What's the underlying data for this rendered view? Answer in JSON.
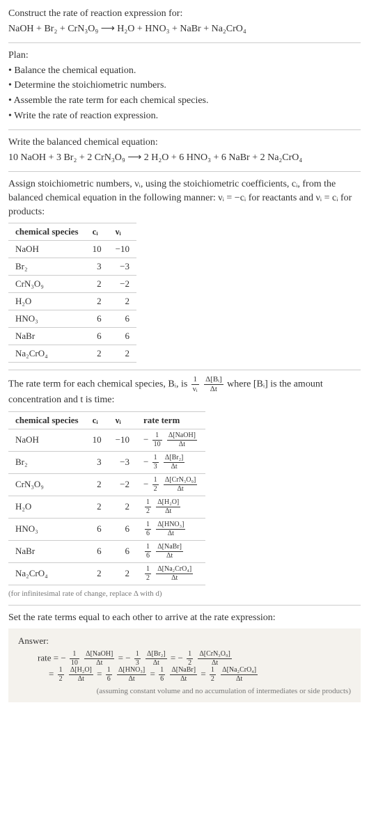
{
  "intro": {
    "title": "Construct the rate of reaction expression for:",
    "equation": "NaOH + Br₂ + CrN₃O₉ ⟶ H₂O + HNO₃ + NaBr + Na₂CrO₄"
  },
  "plan": {
    "heading": "Plan:",
    "items": [
      "• Balance the chemical equation.",
      "• Determine the stoichiometric numbers.",
      "• Assemble the rate term for each chemical species.",
      "• Write the rate of reaction expression."
    ]
  },
  "balanced": {
    "heading": "Write the balanced chemical equation:",
    "equation": "10 NaOH + 3 Br₂ + 2 CrN₃O₉ ⟶ 2 H₂O + 6 HNO₃ + 6 NaBr + 2 Na₂CrO₄"
  },
  "assign": {
    "text": "Assign stoichiometric numbers, νᵢ, using the stoichiometric coefficients, cᵢ, from the balanced chemical equation in the following manner: νᵢ = −cᵢ for reactants and νᵢ = cᵢ for products:"
  },
  "table1": {
    "headers": [
      "chemical species",
      "cᵢ",
      "νᵢ"
    ],
    "rows": [
      {
        "species": "NaOH",
        "c": "10",
        "v": "−10"
      },
      {
        "species": "Br₂",
        "c": "3",
        "v": "−3"
      },
      {
        "species": "CrN₃O₉",
        "c": "2",
        "v": "−2"
      },
      {
        "species": "H₂O",
        "c": "2",
        "v": "2"
      },
      {
        "species": "HNO₃",
        "c": "6",
        "v": "6"
      },
      {
        "species": "NaBr",
        "c": "6",
        "v": "6"
      },
      {
        "species": "Na₂CrO₄",
        "c": "2",
        "v": "2"
      }
    ]
  },
  "rate_intro": {
    "part1": "The rate term for each chemical species, Bᵢ, is ",
    "frac1_num": "1",
    "frac1_den": "νᵢ",
    "frac2_num": "Δ[Bᵢ]",
    "frac2_den": "Δt",
    "part2": " where [Bᵢ] is the amount concentration and t is time:"
  },
  "table2": {
    "headers": [
      "chemical species",
      "cᵢ",
      "νᵢ",
      "rate term"
    ],
    "rows": [
      {
        "species": "NaOH",
        "c": "10",
        "v": "−10",
        "neg": "−",
        "coef_num": "1",
        "coef_den": "10",
        "d_num": "Δ[NaOH]",
        "d_den": "Δt"
      },
      {
        "species": "Br₂",
        "c": "3",
        "v": "−3",
        "neg": "−",
        "coef_num": "1",
        "coef_den": "3",
        "d_num": "Δ[Br₂]",
        "d_den": "Δt"
      },
      {
        "species": "CrN₃O₉",
        "c": "2",
        "v": "−2",
        "neg": "−",
        "coef_num": "1",
        "coef_den": "2",
        "d_num": "Δ[CrN₃O₉]",
        "d_den": "Δt"
      },
      {
        "species": "H₂O",
        "c": "2",
        "v": "2",
        "neg": "",
        "coef_num": "1",
        "coef_den": "2",
        "d_num": "Δ[H₂O]",
        "d_den": "Δt"
      },
      {
        "species": "HNO₃",
        "c": "6",
        "v": "6",
        "neg": "",
        "coef_num": "1",
        "coef_den": "6",
        "d_num": "Δ[HNO₃]",
        "d_den": "Δt"
      },
      {
        "species": "NaBr",
        "c": "6",
        "v": "6",
        "neg": "",
        "coef_num": "1",
        "coef_den": "6",
        "d_num": "Δ[NaBr]",
        "d_den": "Δt"
      },
      {
        "species": "Na₂CrO₄",
        "c": "2",
        "v": "2",
        "neg": "",
        "coef_num": "1",
        "coef_den": "2",
        "d_num": "Δ[Na₂CrO₄]",
        "d_den": "Δt"
      }
    ],
    "footnote": "(for infinitesimal rate of change, replace Δ with d)"
  },
  "set_equal": "Set the rate terms equal to each other to arrive at the rate expression:",
  "answer": {
    "label": "Answer:",
    "rate_label": "rate = ",
    "eq_label": " = ",
    "terms_line1": [
      {
        "neg": "−",
        "cn": "1",
        "cd": "10",
        "dn": "Δ[NaOH]",
        "dd": "Δt"
      },
      {
        "neg": "−",
        "cn": "1",
        "cd": "3",
        "dn": "Δ[Br₂]",
        "dd": "Δt"
      },
      {
        "neg": "−",
        "cn": "1",
        "cd": "2",
        "dn": "Δ[CrN₃O₉]",
        "dd": "Δt"
      }
    ],
    "terms_line2": [
      {
        "neg": "",
        "cn": "1",
        "cd": "2",
        "dn": "Δ[H₂O]",
        "dd": "Δt"
      },
      {
        "neg": "",
        "cn": "1",
        "cd": "6",
        "dn": "Δ[HNO₃]",
        "dd": "Δt"
      },
      {
        "neg": "",
        "cn": "1",
        "cd": "6",
        "dn": "Δ[NaBr]",
        "dd": "Δt"
      },
      {
        "neg": "",
        "cn": "1",
        "cd": "2",
        "dn": "Δ[Na₂CrO₄]",
        "dd": "Δt"
      }
    ],
    "footnote": "(assuming constant volume and no accumulation of intermediates or side products)"
  }
}
